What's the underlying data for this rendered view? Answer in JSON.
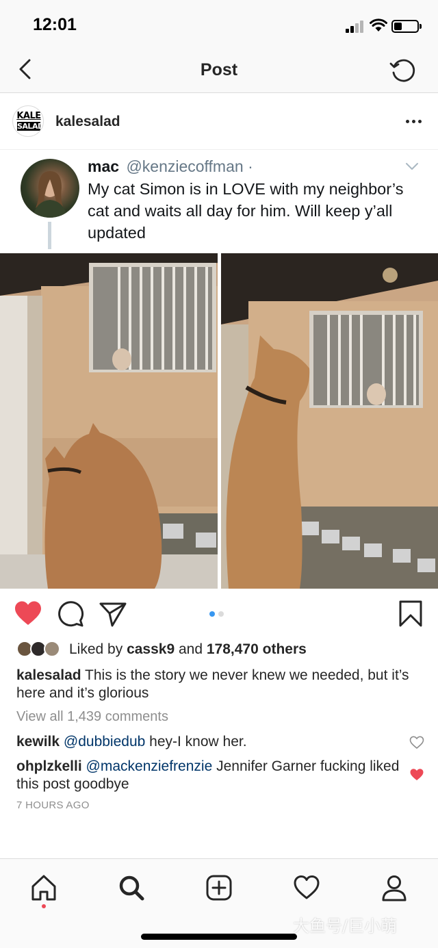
{
  "status_bar": {
    "time": "12:01"
  },
  "nav": {
    "title": "Post"
  },
  "post": {
    "username": "kalesalad",
    "avatar_text_top": "KALE",
    "avatar_text_bottom": "SALAD"
  },
  "tweet": {
    "name": "mac",
    "handle": "@kenziecoffman",
    "separator": "·",
    "text": "My cat Simon is in LOVE with my neighbor’s cat and waits all day for him. Will keep y’all updated"
  },
  "carousel": {
    "total": 2,
    "active": 1
  },
  "likes": {
    "prefix": "Liked by",
    "user": "cassk9",
    "middle": "and",
    "count": "178,470 others"
  },
  "caption": {
    "username": "kalesalad",
    "text": "This is the story we never knew we needed, but it’s here and it’s glorious"
  },
  "view_all": "View all 1,439 comments",
  "comments": [
    {
      "username": "kewilk",
      "mention": "@dubbiedub",
      "text": "hey-I know her.",
      "liked": false
    },
    {
      "username": "ohplzkelli",
      "mention": "@mackenziefrenzie",
      "text": "Jennifer Garner fucking liked this post goodbye",
      "liked": true
    }
  ],
  "timestamp": "7 HOURS AGO",
  "watermark": "大鱼号/巨小萌",
  "colors": {
    "like_red": "#ed4956",
    "carousel_active": "#3897f0",
    "link": "#003569",
    "muted": "#8e8e8e"
  }
}
